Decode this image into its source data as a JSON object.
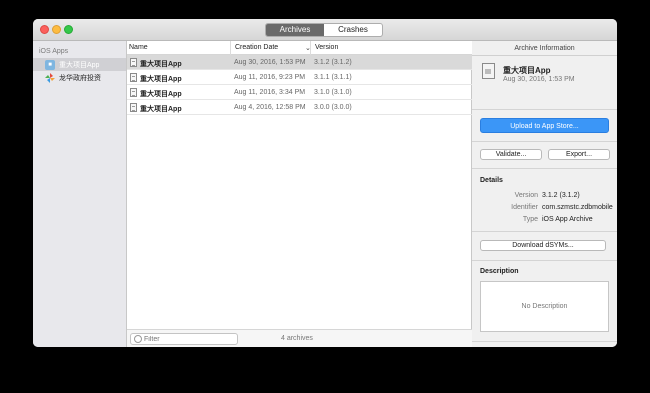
{
  "titlebar": {
    "tabs": [
      {
        "label": "Archives",
        "active": true
      },
      {
        "label": "Crashes",
        "active": false
      }
    ]
  },
  "sidebar": {
    "heading": "iOS Apps",
    "items": [
      {
        "label": "重大项目App",
        "selected": true,
        "icon": "ios-app-icon"
      },
      {
        "label": "龙华政府投资",
        "selected": false,
        "icon": "pinwheel-app-icon"
      }
    ]
  },
  "list": {
    "columns": {
      "name": "Name",
      "date": "Creation Date",
      "version": "Version"
    },
    "rows": [
      {
        "name": "重大项目App",
        "date": "Aug 30, 2016, 1:53 PM",
        "version": "3.1.2 (3.1.2)",
        "selected": true
      },
      {
        "name": "重大项目App",
        "date": "Aug 11, 2016, 9:23 PM",
        "version": "3.1.1 (3.1.1)",
        "selected": false
      },
      {
        "name": "重大项目App",
        "date": "Aug 11, 2016, 3:34 PM",
        "version": "3.1.0 (3.1.0)",
        "selected": false
      },
      {
        "name": "重大项目App",
        "date": "Aug 4, 2016, 12:58 PM",
        "version": "3.0.0 (3.0.0)",
        "selected": false
      }
    ],
    "filter_placeholder": "Filter",
    "count": "4 archives"
  },
  "inspector": {
    "title": "Archive Information",
    "archive_name": "重大项目App",
    "archive_date": "Aug 30, 2016, 1:53 PM",
    "upload_button": "Upload to App Store...",
    "validate_button": "Validate...",
    "export_button": "Export...",
    "details_label": "Details",
    "details": {
      "version_key": "Version",
      "version_value": "3.1.2 (3.1.2)",
      "identifier_key": "Identifier",
      "identifier_value": "com.szmstc.zdbmobile",
      "type_key": "Type",
      "type_value": "iOS App Archive"
    },
    "dsyms_button": "Download dSYMs...",
    "description_label": "Description",
    "description_placeholder": "No Description"
  }
}
